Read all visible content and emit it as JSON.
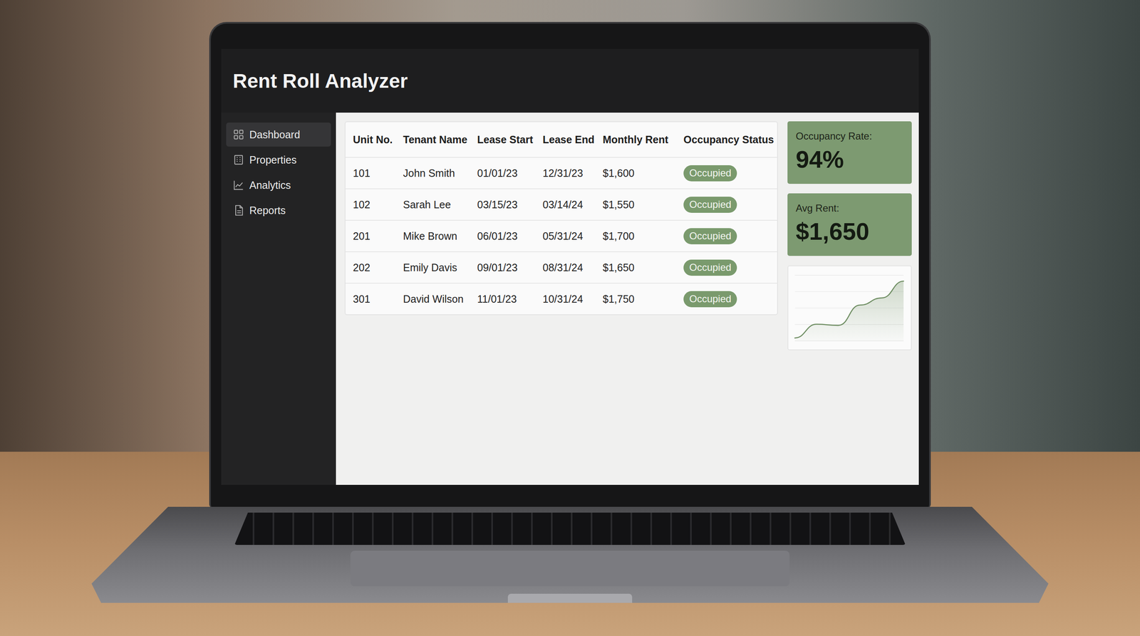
{
  "window": {
    "title": "Rent Roll Analyzer"
  },
  "sidebar": {
    "items": [
      {
        "label": "Dashboard",
        "selected": true
      },
      {
        "label": "Properties",
        "selected": false
      },
      {
        "label": "Analytics",
        "selected": false
      },
      {
        "label": "Reports",
        "selected": false
      }
    ]
  },
  "table": {
    "columns": [
      "Unit No.",
      "Tenant Name",
      "Lease Start",
      "Lease End",
      "Monthly Rent",
      "Occupancy Status"
    ],
    "rows": [
      {
        "unit": "101",
        "tenant": "John Smith",
        "lease_start": "01/01/23",
        "lease_end": "12/31/23",
        "rent": "$1,600",
        "status": "Occupied"
      },
      {
        "unit": "102",
        "tenant": "Sarah Lee",
        "lease_start": "03/15/23",
        "lease_end": "03/14/24",
        "rent": "$1,550",
        "status": "Occupied"
      },
      {
        "unit": "201",
        "tenant": "Mike Brown",
        "lease_start": "06/01/23",
        "lease_end": "05/31/24",
        "rent": "$1,700",
        "status": "Occupied"
      },
      {
        "unit": "202",
        "tenant": "Emily Davis",
        "lease_start": "09/01/23",
        "lease_end": "08/31/24",
        "rent": "$1,650",
        "status": "Occupied"
      },
      {
        "unit": "301",
        "tenant": "David Wilson",
        "lease_start": "11/01/23",
        "lease_end": "10/31/24",
        "rent": "$1,750",
        "status": "Occupied"
      }
    ]
  },
  "stats": [
    {
      "label": "Occupancy Rate:",
      "value": "94%"
    },
    {
      "label": "Avg Rent:",
      "value": "$1,650"
    }
  ],
  "chart": {
    "series": [
      {
        "values": [
          5,
          28,
          26,
          60,
          72,
          100
        ]
      }
    ]
  }
}
